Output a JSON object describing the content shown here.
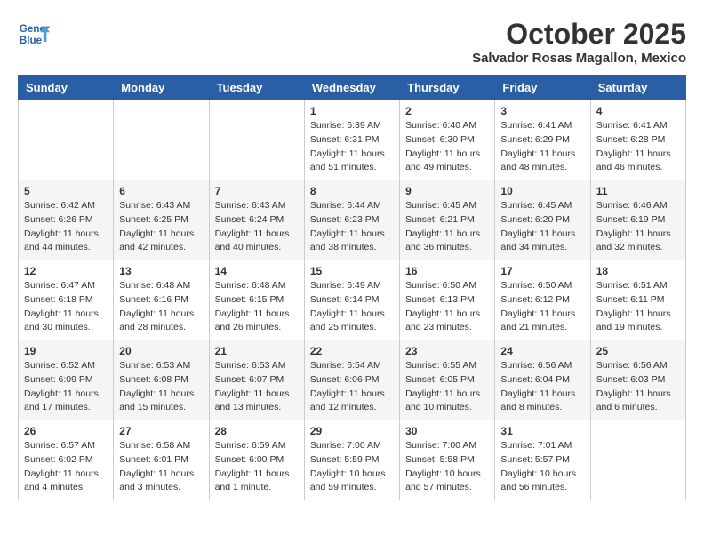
{
  "header": {
    "logo_line1": "General",
    "logo_line2": "Blue",
    "month": "October 2025",
    "location": "Salvador Rosas Magallon, Mexico"
  },
  "weekdays": [
    "Sunday",
    "Monday",
    "Tuesday",
    "Wednesday",
    "Thursday",
    "Friday",
    "Saturday"
  ],
  "weeks": [
    [
      {
        "day": "",
        "info": ""
      },
      {
        "day": "",
        "info": ""
      },
      {
        "day": "",
        "info": ""
      },
      {
        "day": "1",
        "info": "Sunrise: 6:39 AM\nSunset: 6:31 PM\nDaylight: 11 hours\nand 51 minutes."
      },
      {
        "day": "2",
        "info": "Sunrise: 6:40 AM\nSunset: 6:30 PM\nDaylight: 11 hours\nand 49 minutes."
      },
      {
        "day": "3",
        "info": "Sunrise: 6:41 AM\nSunset: 6:29 PM\nDaylight: 11 hours\nand 48 minutes."
      },
      {
        "day": "4",
        "info": "Sunrise: 6:41 AM\nSunset: 6:28 PM\nDaylight: 11 hours\nand 46 minutes."
      }
    ],
    [
      {
        "day": "5",
        "info": "Sunrise: 6:42 AM\nSunset: 6:26 PM\nDaylight: 11 hours\nand 44 minutes."
      },
      {
        "day": "6",
        "info": "Sunrise: 6:43 AM\nSunset: 6:25 PM\nDaylight: 11 hours\nand 42 minutes."
      },
      {
        "day": "7",
        "info": "Sunrise: 6:43 AM\nSunset: 6:24 PM\nDaylight: 11 hours\nand 40 minutes."
      },
      {
        "day": "8",
        "info": "Sunrise: 6:44 AM\nSunset: 6:23 PM\nDaylight: 11 hours\nand 38 minutes."
      },
      {
        "day": "9",
        "info": "Sunrise: 6:45 AM\nSunset: 6:21 PM\nDaylight: 11 hours\nand 36 minutes."
      },
      {
        "day": "10",
        "info": "Sunrise: 6:45 AM\nSunset: 6:20 PM\nDaylight: 11 hours\nand 34 minutes."
      },
      {
        "day": "11",
        "info": "Sunrise: 6:46 AM\nSunset: 6:19 PM\nDaylight: 11 hours\nand 32 minutes."
      }
    ],
    [
      {
        "day": "12",
        "info": "Sunrise: 6:47 AM\nSunset: 6:18 PM\nDaylight: 11 hours\nand 30 minutes."
      },
      {
        "day": "13",
        "info": "Sunrise: 6:48 AM\nSunset: 6:16 PM\nDaylight: 11 hours\nand 28 minutes."
      },
      {
        "day": "14",
        "info": "Sunrise: 6:48 AM\nSunset: 6:15 PM\nDaylight: 11 hours\nand 26 minutes."
      },
      {
        "day": "15",
        "info": "Sunrise: 6:49 AM\nSunset: 6:14 PM\nDaylight: 11 hours\nand 25 minutes."
      },
      {
        "day": "16",
        "info": "Sunrise: 6:50 AM\nSunset: 6:13 PM\nDaylight: 11 hours\nand 23 minutes."
      },
      {
        "day": "17",
        "info": "Sunrise: 6:50 AM\nSunset: 6:12 PM\nDaylight: 11 hours\nand 21 minutes."
      },
      {
        "day": "18",
        "info": "Sunrise: 6:51 AM\nSunset: 6:11 PM\nDaylight: 11 hours\nand 19 minutes."
      }
    ],
    [
      {
        "day": "19",
        "info": "Sunrise: 6:52 AM\nSunset: 6:09 PM\nDaylight: 11 hours\nand 17 minutes."
      },
      {
        "day": "20",
        "info": "Sunrise: 6:53 AM\nSunset: 6:08 PM\nDaylight: 11 hours\nand 15 minutes."
      },
      {
        "day": "21",
        "info": "Sunrise: 6:53 AM\nSunset: 6:07 PM\nDaylight: 11 hours\nand 13 minutes."
      },
      {
        "day": "22",
        "info": "Sunrise: 6:54 AM\nSunset: 6:06 PM\nDaylight: 11 hours\nand 12 minutes."
      },
      {
        "day": "23",
        "info": "Sunrise: 6:55 AM\nSunset: 6:05 PM\nDaylight: 11 hours\nand 10 minutes."
      },
      {
        "day": "24",
        "info": "Sunrise: 6:56 AM\nSunset: 6:04 PM\nDaylight: 11 hours\nand 8 minutes."
      },
      {
        "day": "25",
        "info": "Sunrise: 6:56 AM\nSunset: 6:03 PM\nDaylight: 11 hours\nand 6 minutes."
      }
    ],
    [
      {
        "day": "26",
        "info": "Sunrise: 6:57 AM\nSunset: 6:02 PM\nDaylight: 11 hours\nand 4 minutes."
      },
      {
        "day": "27",
        "info": "Sunrise: 6:58 AM\nSunset: 6:01 PM\nDaylight: 11 hours\nand 3 minutes."
      },
      {
        "day": "28",
        "info": "Sunrise: 6:59 AM\nSunset: 6:00 PM\nDaylight: 11 hours\nand 1 minute."
      },
      {
        "day": "29",
        "info": "Sunrise: 7:00 AM\nSunset: 5:59 PM\nDaylight: 10 hours\nand 59 minutes."
      },
      {
        "day": "30",
        "info": "Sunrise: 7:00 AM\nSunset: 5:58 PM\nDaylight: 10 hours\nand 57 minutes."
      },
      {
        "day": "31",
        "info": "Sunrise: 7:01 AM\nSunset: 5:57 PM\nDaylight: 10 hours\nand 56 minutes."
      },
      {
        "day": "",
        "info": ""
      }
    ]
  ]
}
